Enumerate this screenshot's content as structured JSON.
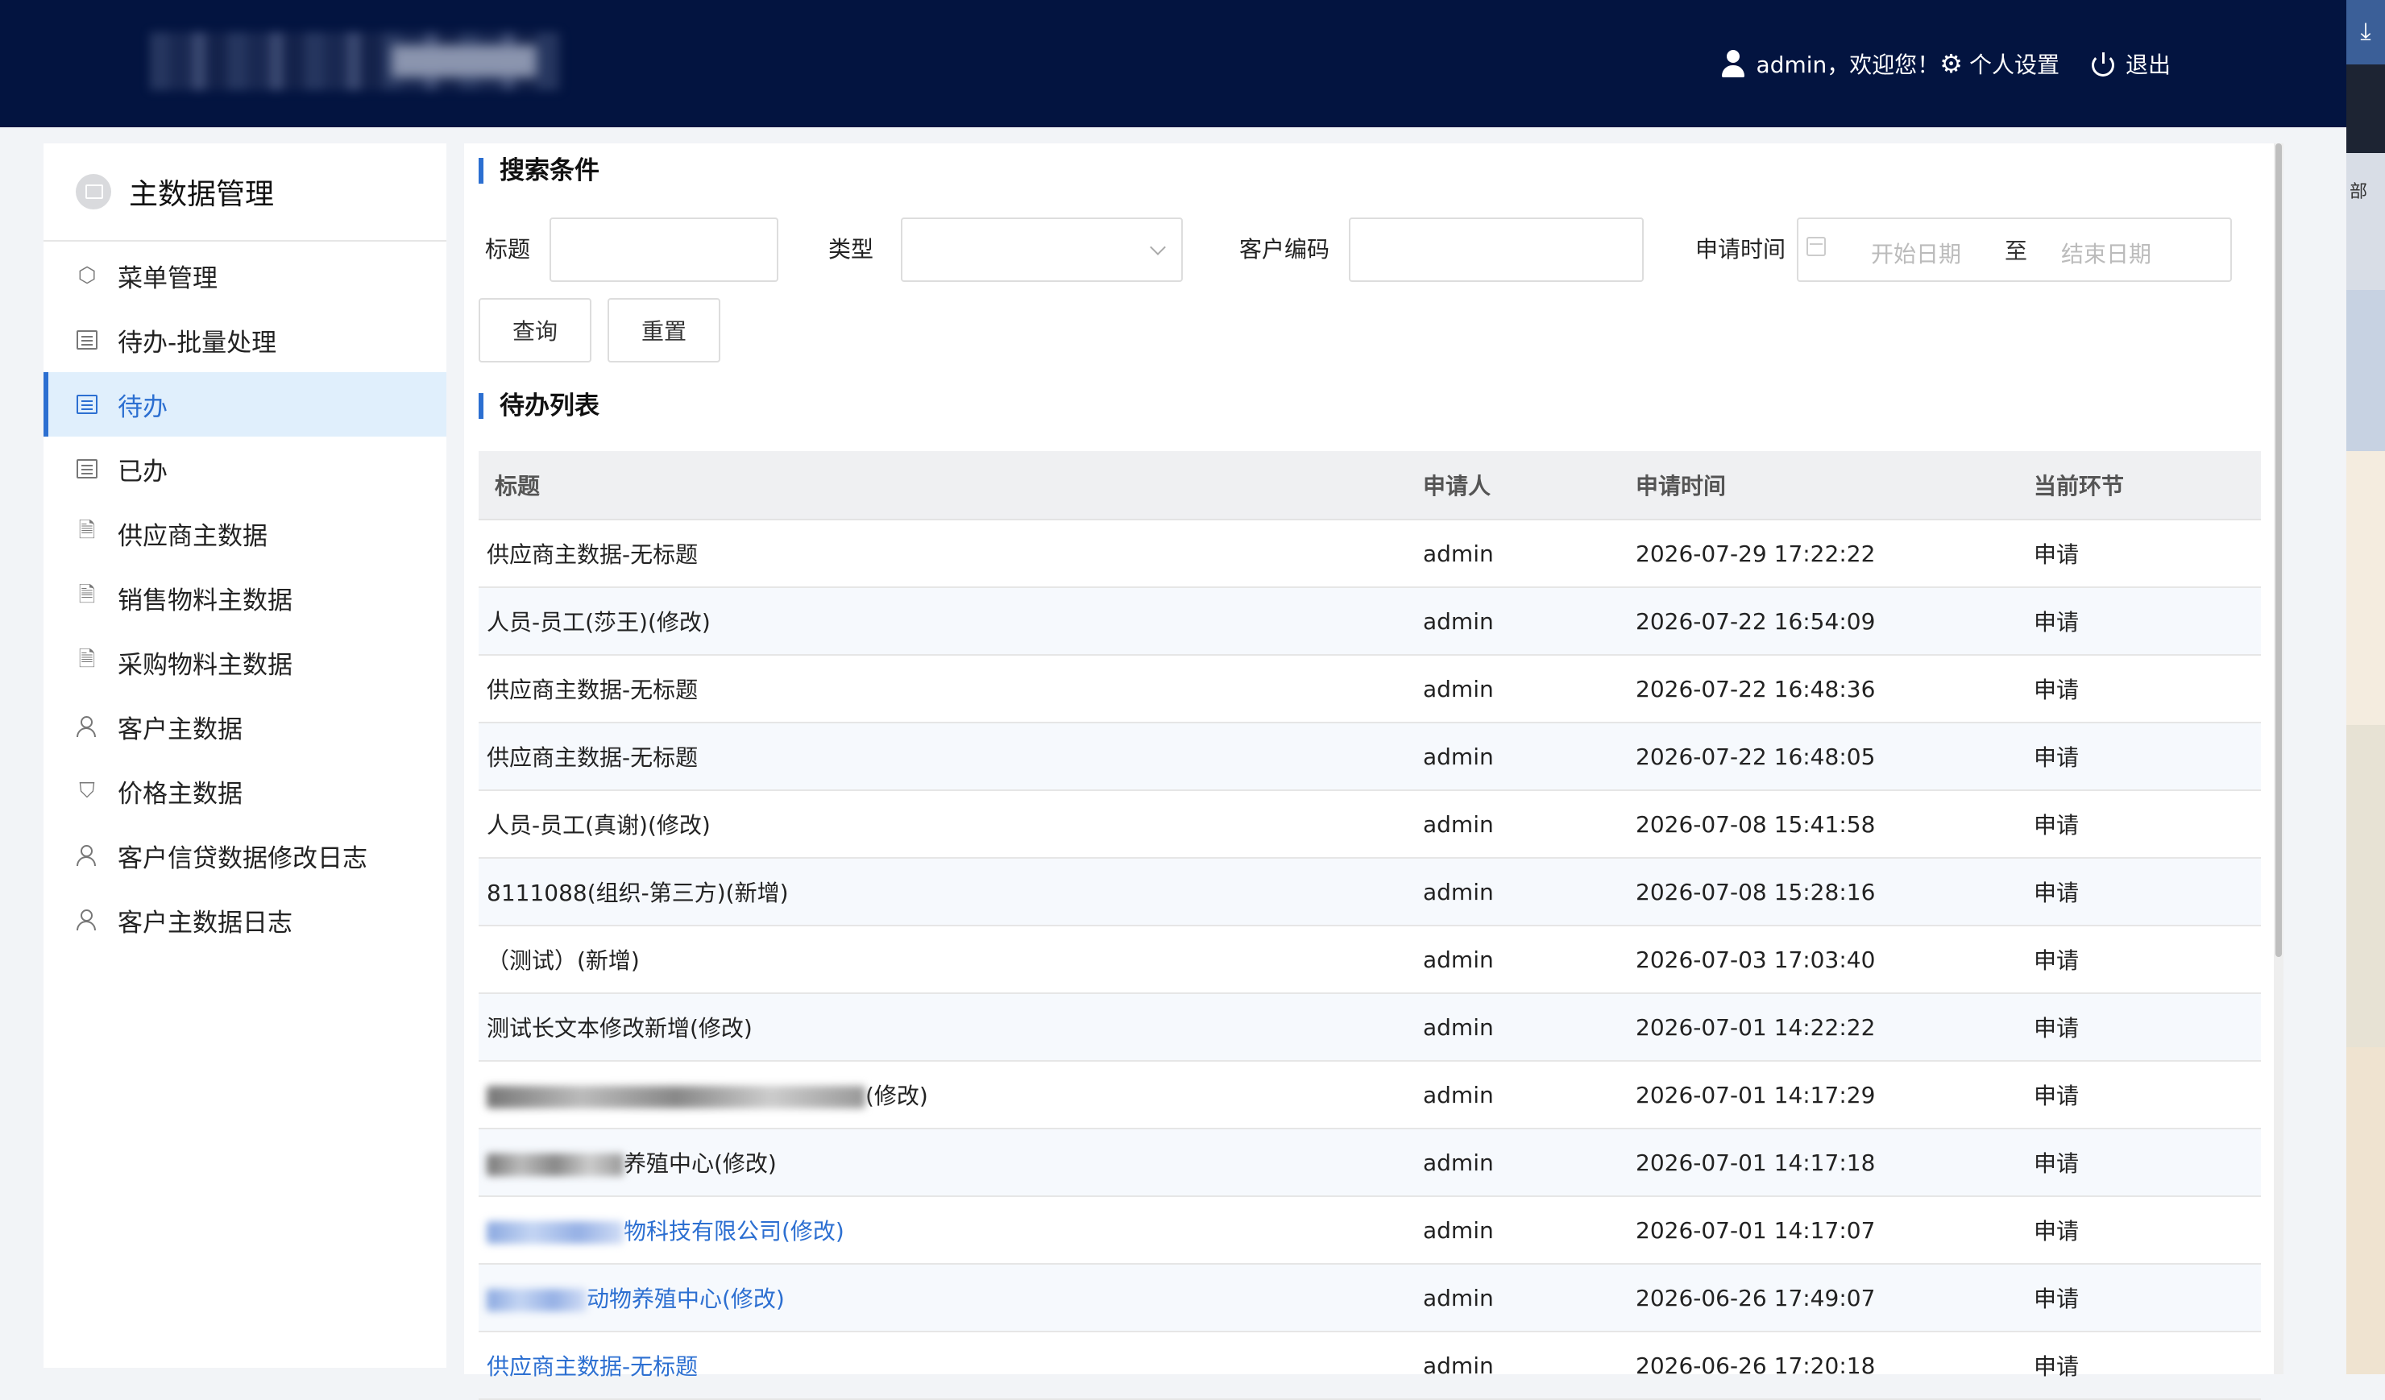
{
  "header": {
    "user_greeting": "admin，欢迎您！",
    "settings_label": "个人设置",
    "logout_label": "退出"
  },
  "right_edge": {
    "fragment_text": "部"
  },
  "sidebar": {
    "title": "主数据管理",
    "items": [
      {
        "label": "菜单管理",
        "icon": "settings-icon"
      },
      {
        "label": "待办-批量处理",
        "icon": "list-icon"
      },
      {
        "label": "待办",
        "icon": "list-icon",
        "active": true
      },
      {
        "label": "已办",
        "icon": "list-icon"
      },
      {
        "label": "供应商主数据",
        "icon": "document-icon"
      },
      {
        "label": "销售物料主数据",
        "icon": "document-icon"
      },
      {
        "label": "采购物料主数据",
        "icon": "document-icon"
      },
      {
        "label": "客户主数据",
        "icon": "users-icon"
      },
      {
        "label": "价格主数据",
        "icon": "shield-icon"
      },
      {
        "label": "客户信贷数据修改日志",
        "icon": "users-icon"
      },
      {
        "label": "客户主数据日志",
        "icon": "users-icon"
      }
    ]
  },
  "search": {
    "section_title": "搜索条件",
    "title_label": "标题",
    "title_value": "",
    "type_label": "类型",
    "type_value": "",
    "customer_code_label": "客户编码",
    "customer_code_value": "",
    "apply_time_label": "申请时间",
    "start_placeholder": "开始日期",
    "range_sep": "至",
    "end_placeholder": "结束日期",
    "query_button": "查询",
    "reset_button": "重置"
  },
  "todo_list": {
    "section_title": "待办列表",
    "columns": [
      "标题",
      "申请人",
      "申请时间",
      "当前环节"
    ],
    "rows": [
      {
        "title": "供应商主数据-无标题",
        "applicant": "admin",
        "time": "2026-07-29 17:22:22",
        "stage": "申请"
      },
      {
        "title": "人员-员工(莎王)(修改)",
        "applicant": "admin",
        "time": "2026-07-22 16:54:09",
        "stage": "申请"
      },
      {
        "title": "供应商主数据-无标题",
        "applicant": "admin",
        "time": "2026-07-22 16:48:36",
        "stage": "申请"
      },
      {
        "title": "供应商主数据-无标题",
        "applicant": "admin",
        "time": "2026-07-22 16:48:05",
        "stage": "申请"
      },
      {
        "title": "人员-员工(真谢)(修改)",
        "applicant": "admin",
        "time": "2026-07-08 15:41:58",
        "stage": "申请"
      },
      {
        "title": "8111088(组织-第三方)(新增)",
        "applicant": "admin",
        "time": "2026-07-08 15:28:16",
        "stage": "申请"
      },
      {
        "title": "（测试）(新增)",
        "applicant": "admin",
        "time": "2026-07-03 17:03:40",
        "stage": "申请"
      },
      {
        "title": "测试长文本修改新增(修改)",
        "applicant": "admin",
        "time": "2026-07-01 14:22:22",
        "stage": "申请"
      },
      {
        "title": "(修改)",
        "applicant": "admin",
        "time": "2026-07-01 14:17:29",
        "stage": "申请",
        "redacted": "gray",
        "blur_width": 470
      },
      {
        "title": "养殖中心(修改)",
        "applicant": "admin",
        "time": "2026-07-01 14:17:18",
        "stage": "申请",
        "redacted": "gray",
        "blur_width": 170
      },
      {
        "title": "物科技有限公司(修改)",
        "applicant": "admin",
        "time": "2026-07-01 14:17:07",
        "stage": "申请",
        "redacted": "blue",
        "blur_width": 170,
        "link": true
      },
      {
        "title": "动物养殖中心(修改)",
        "applicant": "admin",
        "time": "2026-06-26 17:49:07",
        "stage": "申请",
        "redacted": "blue",
        "blur_width": 124,
        "link": true
      },
      {
        "title": "供应商主数据-无标题",
        "applicant": "admin",
        "time": "2026-06-26 17:20:18",
        "stage": "申请",
        "link": true
      }
    ]
  },
  "colors": {
    "header_bg": "#031440",
    "accent": "#2c6fd1",
    "active_bg": "#e0effc"
  }
}
